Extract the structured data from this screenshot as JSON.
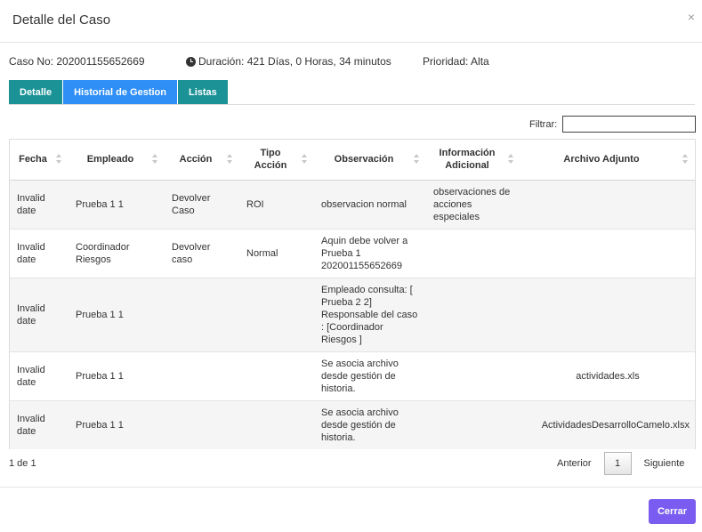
{
  "modal": {
    "title": "Detalle del Caso",
    "close_glyph": "×"
  },
  "case_info": {
    "case_no": "Caso No: 202001155652669",
    "duration": "Duración: 421 Días, 0 Horas, 34 minutos",
    "priority": "Prioridad: Alta"
  },
  "tabs": [
    {
      "label": "Detalle",
      "active": false
    },
    {
      "label": "Historial de Gestion",
      "active": true
    },
    {
      "label": "Listas",
      "active": false
    }
  ],
  "filter": {
    "label": "Filtrar:",
    "value": ""
  },
  "table": {
    "columns": [
      "Fecha",
      "Empleado",
      "Acción",
      "Tipo Acción",
      "Observación",
      "Información Adicional",
      "Archivo Adjunto"
    ],
    "rows": [
      [
        "Invalid date",
        "Prueba 1 1",
        "Devolver Caso",
        "ROI",
        "observacion normal",
        "observaciones de acciones especiales",
        ""
      ],
      [
        "Invalid date",
        "Coordinador Riesgos",
        "Devolver caso",
        "Normal",
        "Aquin debe volver a Prueba 1 202001155652669",
        "",
        ""
      ],
      [
        "Invalid date",
        "Prueba 1 1",
        "",
        "",
        "Empleado consulta: [ Prueba 2 2] Responsable del caso : [Coordinador Riesgos ]",
        "",
        ""
      ],
      [
        "Invalid date",
        "Prueba 1 1",
        "",
        "",
        "Se asocia archivo desde gestión de historia.",
        "",
        "actividades.xls"
      ],
      [
        "Invalid date",
        "Prueba 1 1",
        "",
        "",
        "Se asocia archivo desde gestión de historia.",
        "",
        "ActividadesDesarrolloCamelo.xlsx"
      ]
    ]
  },
  "pagination": {
    "summary": "1 de 1",
    "prev_label": "Anterior",
    "current_page": "1",
    "next_label": "Siguiente"
  },
  "footer": {
    "close_label": "Cerrar"
  },
  "colors": {
    "tab_teal": "#1a9296",
    "tab_active": "#2f8ff7",
    "close_button": "#7a5df0"
  }
}
